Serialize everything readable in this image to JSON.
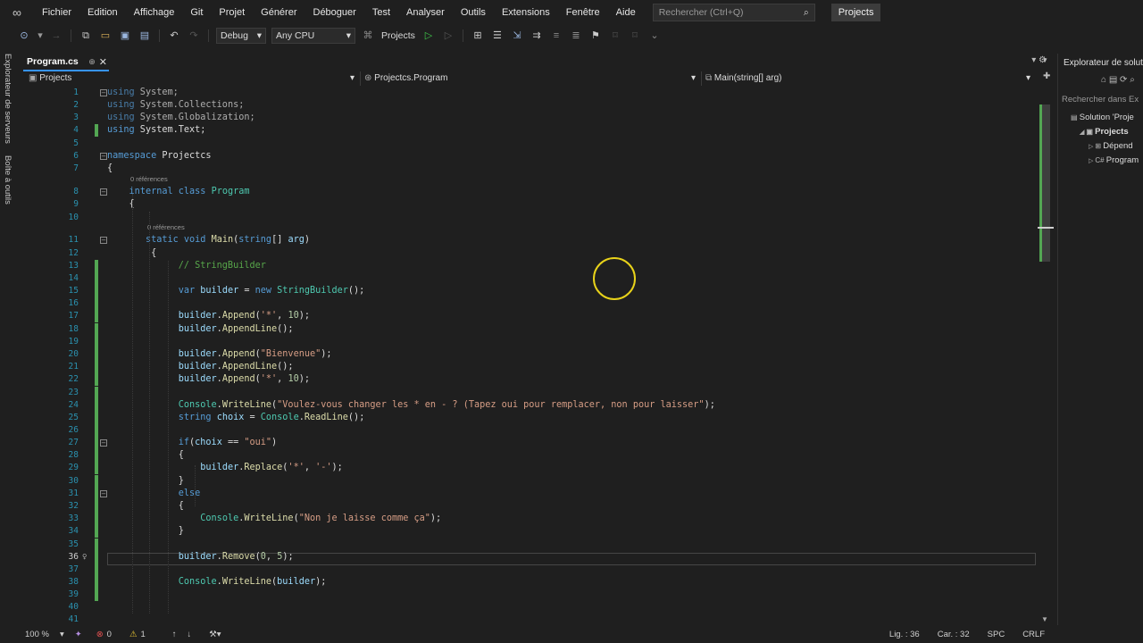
{
  "menu": {
    "items": [
      "Fichier",
      "Edition",
      "Affichage",
      "Git",
      "Projet",
      "Générer",
      "Déboguer",
      "Test",
      "Analyser",
      "Outils",
      "Extensions",
      "Fenêtre",
      "Aide"
    ],
    "search_placeholder": "Rechercher (Ctrl+Q)",
    "project_badge": "Projects"
  },
  "toolbar": {
    "config": "Debug",
    "platform": "Any CPU",
    "start_target": "Projects"
  },
  "left_strip": [
    "Explorateur de serveurs",
    "Boîte à outils"
  ],
  "tab": {
    "label": "Program.cs",
    "pin": "⊕",
    "close": "✕"
  },
  "nav": {
    "project": "Projects",
    "class": "Projectcs.Program",
    "member": "Main(string[] arg)"
  },
  "editor": {
    "references_label": "0 références",
    "lines": [
      {
        "n": "1",
        "html": "<span class='kw'>using</span> System;",
        "fold": "⊟",
        "dim": true
      },
      {
        "n": "2",
        "html": "<span class='kw'>using</span> System.Collections;",
        "dim": true
      },
      {
        "n": "3",
        "html": "<span class='kw'>using</span> System.Globalization;",
        "dim": true
      },
      {
        "n": "4",
        "html": "<span class='kw'>using</span> System.Text;",
        "chg": true
      },
      {
        "n": "5",
        "html": ""
      },
      {
        "n": "6",
        "html": "<span class='kw'>namespace</span> Projectcs",
        "fold": "⊟"
      },
      {
        "n": "7",
        "html": "{"
      },
      {
        "n": "8",
        "html": "    <span class='kw'>internal</span> <span class='kw'>class</span> <span class='ty'>Program</span>",
        "fold": "⊟",
        "ref": true
      },
      {
        "n": "9",
        "html": "    {"
      },
      {
        "n": "10",
        "html": ""
      },
      {
        "n": "11",
        "html": "       <span class='kw'>static</span> <span class='kw'>void</span> <span class='mt'>Main</span>(<span class='kw'>string</span>[] <span class='vr'>arg</span>)",
        "fold": "⊟",
        "ref": true
      },
      {
        "n": "12",
        "html": "        {"
      },
      {
        "n": "13",
        "html": "             <span class='cm'>// StringBuilder</span>",
        "chg": true
      },
      {
        "n": "14",
        "html": "",
        "chg": true
      },
      {
        "n": "15",
        "html": "             <span class='kw'>var</span> <span class='vr'>builder</span> = <span class='kw'>new</span> <span class='ty'>StringBuilder</span>();",
        "chg": true
      },
      {
        "n": "16",
        "html": "",
        "chg": true
      },
      {
        "n": "17",
        "html": "             <span class='vr'>builder</span>.<span class='mt'>Append</span>(<span class='st'>'*'</span>, <span class='nm'>10</span>);",
        "chg": true
      },
      {
        "n": "18",
        "html": "             <span class='vr'>builder</span>.<span class='mt'>AppendLine</span>();",
        "chg": true
      },
      {
        "n": "19",
        "html": "",
        "chg": true
      },
      {
        "n": "20",
        "html": "             <span class='vr'>builder</span>.<span class='mt'>Append</span>(<span class='st'>\"Bienvenue\"</span>);",
        "chg": true
      },
      {
        "n": "21",
        "html": "             <span class='vr'>builder</span>.<span class='mt'>AppendLine</span>();",
        "chg": true
      },
      {
        "n": "22",
        "html": "             <span class='vr'>builder</span>.<span class='mt'>Append</span>(<span class='st'>'*'</span>, <span class='nm'>10</span>);",
        "chg": true
      },
      {
        "n": "23",
        "html": "",
        "chg": true
      },
      {
        "n": "24",
        "html": "             <span class='ty'>Console</span>.<span class='mt'>WriteLine</span>(<span class='st'>\"Voulez-vous changer les * en - ? (Tapez oui pour remplacer, non pour laisser\"</span>);",
        "chg": true
      },
      {
        "n": "25",
        "html": "             <span class='kw'>string</span> <span class='vr'>choix</span> = <span class='ty'>Console</span>.<span class='mt'>ReadLine</span>();",
        "chg": true
      },
      {
        "n": "26",
        "html": "",
        "chg": true
      },
      {
        "n": "27",
        "html": "             <span class='kw'>if</span>(<span class='vr'>choix</span> == <span class='st'>\"oui\"</span>)",
        "fold": "⊟",
        "chg": true
      },
      {
        "n": "28",
        "html": "             {",
        "chg": true
      },
      {
        "n": "29",
        "html": "                 <span class='vr'>builder</span>.<span class='mt'>Replace</span>(<span class='st'>'*'</span>, <span class='st'>'-'</span>);",
        "chg": true
      },
      {
        "n": "30",
        "html": "             }",
        "chg": true
      },
      {
        "n": "31",
        "html": "             <span class='kw'>else</span>",
        "fold": "⊟",
        "chg": true
      },
      {
        "n": "32",
        "html": "             {",
        "chg": true
      },
      {
        "n": "33",
        "html": "                 <span class='ty'>Console</span>.<span class='mt'>WriteLine</span>(<span class='st'>\"Non je laisse comme ça\"</span>);",
        "chg": true
      },
      {
        "n": "34",
        "html": "             }",
        "chg": true
      },
      {
        "n": "35",
        "html": "",
        "chg": true
      },
      {
        "n": "36",
        "html": "             <span class='vr'>builder</span>.<span class='mt'>Remove</span>(<span class='nm'>0</span>, <span class='nm'>5</span>);",
        "chg": true,
        "current": true
      },
      {
        "n": "37",
        "html": "",
        "chg": true
      },
      {
        "n": "38",
        "html": "             <span class='ty'>Console</span>.<span class='mt'>WriteLine</span>(<span class='vr'>builder</span>);",
        "chg": true
      },
      {
        "n": "39",
        "html": "",
        "chg": true
      },
      {
        "n": "40",
        "html": ""
      },
      {
        "n": "41",
        "html": ""
      }
    ]
  },
  "status": {
    "zoom": "100 %",
    "errors": "0",
    "warnings": "1",
    "line": "Lig. : 36",
    "col": "Car. : 32",
    "spc": "SPC",
    "crlf": "CRLF"
  },
  "solution_explorer": {
    "title": "Explorateur de solut",
    "search": "Rechercher dans Ex",
    "items": [
      {
        "label": "Solution 'Proje",
        "indent": 0
      },
      {
        "label": "Projects",
        "indent": 1,
        "bold": true
      },
      {
        "label": "Dépend",
        "indent": 2
      },
      {
        "label": "Program",
        "indent": 2
      }
    ]
  }
}
